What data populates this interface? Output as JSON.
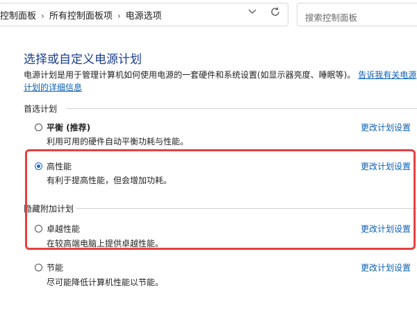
{
  "breadcrumb": {
    "items": [
      "控制面板",
      "所有控制面板项",
      "电源选项"
    ]
  },
  "search": {
    "placeholder": "搜索控制面板"
  },
  "main": {
    "title": "选择或自定义电源计划",
    "description": "电源计划是用于管理计算机如何使用电源的一套硬件和系统设置(如显示器亮度、睡眠等)。",
    "description_link": "告诉我有关电源计划的详细信息"
  },
  "preferred_group": {
    "label": "首选计划",
    "plans": [
      {
        "name": "平衡 (推荐)",
        "description": "利用可用的硬件自动平衡功耗与性能。",
        "link": "更改计划设置",
        "selected": false
      },
      {
        "name": "高性能",
        "description": "有利于提高性能，但会增加功耗。",
        "link": "更改计划设置",
        "selected": true
      }
    ]
  },
  "hidden_group": {
    "label": "隐藏附加计划",
    "plans": [
      {
        "name": "卓越性能",
        "description": "在较高端电脑上提供卓越性能。",
        "link": "更改计划设置",
        "selected": false
      },
      {
        "name": "节能",
        "description": "尽可能降低计算机性能以节能。",
        "link": "更改计划设置",
        "selected": false
      }
    ]
  },
  "colors": {
    "title": "#1a3d8f",
    "link": "#0a5fb4",
    "highlight_border": "#e5403f",
    "radio_selected": "#1a66c7"
  },
  "icons": [
    "chevron-right-icon",
    "chevron-down-icon",
    "refresh-icon"
  ]
}
